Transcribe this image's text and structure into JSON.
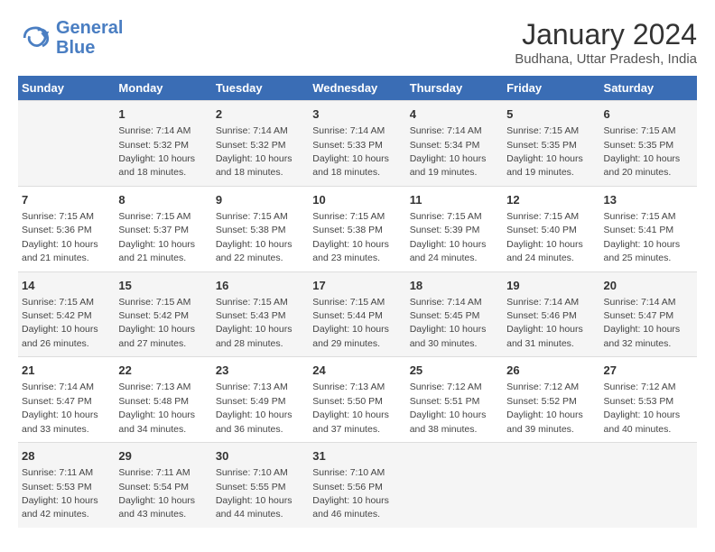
{
  "header": {
    "logo_line1": "General",
    "logo_line2": "Blue",
    "title": "January 2024",
    "subtitle": "Budhana, Uttar Pradesh, India"
  },
  "days_of_week": [
    "Sunday",
    "Monday",
    "Tuesday",
    "Wednesday",
    "Thursday",
    "Friday",
    "Saturday"
  ],
  "weeks": [
    [
      {
        "day": "",
        "info": ""
      },
      {
        "day": "1",
        "info": "Sunrise: 7:14 AM\nSunset: 5:32 PM\nDaylight: 10 hours\nand 18 minutes."
      },
      {
        "day": "2",
        "info": "Sunrise: 7:14 AM\nSunset: 5:32 PM\nDaylight: 10 hours\nand 18 minutes."
      },
      {
        "day": "3",
        "info": "Sunrise: 7:14 AM\nSunset: 5:33 PM\nDaylight: 10 hours\nand 18 minutes."
      },
      {
        "day": "4",
        "info": "Sunrise: 7:14 AM\nSunset: 5:34 PM\nDaylight: 10 hours\nand 19 minutes."
      },
      {
        "day": "5",
        "info": "Sunrise: 7:15 AM\nSunset: 5:35 PM\nDaylight: 10 hours\nand 19 minutes."
      },
      {
        "day": "6",
        "info": "Sunrise: 7:15 AM\nSunset: 5:35 PM\nDaylight: 10 hours\nand 20 minutes."
      }
    ],
    [
      {
        "day": "7",
        "info": "Sunrise: 7:15 AM\nSunset: 5:36 PM\nDaylight: 10 hours\nand 21 minutes."
      },
      {
        "day": "8",
        "info": "Sunrise: 7:15 AM\nSunset: 5:37 PM\nDaylight: 10 hours\nand 21 minutes."
      },
      {
        "day": "9",
        "info": "Sunrise: 7:15 AM\nSunset: 5:38 PM\nDaylight: 10 hours\nand 22 minutes."
      },
      {
        "day": "10",
        "info": "Sunrise: 7:15 AM\nSunset: 5:38 PM\nDaylight: 10 hours\nand 23 minutes."
      },
      {
        "day": "11",
        "info": "Sunrise: 7:15 AM\nSunset: 5:39 PM\nDaylight: 10 hours\nand 24 minutes."
      },
      {
        "day": "12",
        "info": "Sunrise: 7:15 AM\nSunset: 5:40 PM\nDaylight: 10 hours\nand 24 minutes."
      },
      {
        "day": "13",
        "info": "Sunrise: 7:15 AM\nSunset: 5:41 PM\nDaylight: 10 hours\nand 25 minutes."
      }
    ],
    [
      {
        "day": "14",
        "info": "Sunrise: 7:15 AM\nSunset: 5:42 PM\nDaylight: 10 hours\nand 26 minutes."
      },
      {
        "day": "15",
        "info": "Sunrise: 7:15 AM\nSunset: 5:42 PM\nDaylight: 10 hours\nand 27 minutes."
      },
      {
        "day": "16",
        "info": "Sunrise: 7:15 AM\nSunset: 5:43 PM\nDaylight: 10 hours\nand 28 minutes."
      },
      {
        "day": "17",
        "info": "Sunrise: 7:15 AM\nSunset: 5:44 PM\nDaylight: 10 hours\nand 29 minutes."
      },
      {
        "day": "18",
        "info": "Sunrise: 7:14 AM\nSunset: 5:45 PM\nDaylight: 10 hours\nand 30 minutes."
      },
      {
        "day": "19",
        "info": "Sunrise: 7:14 AM\nSunset: 5:46 PM\nDaylight: 10 hours\nand 31 minutes."
      },
      {
        "day": "20",
        "info": "Sunrise: 7:14 AM\nSunset: 5:47 PM\nDaylight: 10 hours\nand 32 minutes."
      }
    ],
    [
      {
        "day": "21",
        "info": "Sunrise: 7:14 AM\nSunset: 5:47 PM\nDaylight: 10 hours\nand 33 minutes."
      },
      {
        "day": "22",
        "info": "Sunrise: 7:13 AM\nSunset: 5:48 PM\nDaylight: 10 hours\nand 34 minutes."
      },
      {
        "day": "23",
        "info": "Sunrise: 7:13 AM\nSunset: 5:49 PM\nDaylight: 10 hours\nand 36 minutes."
      },
      {
        "day": "24",
        "info": "Sunrise: 7:13 AM\nSunset: 5:50 PM\nDaylight: 10 hours\nand 37 minutes."
      },
      {
        "day": "25",
        "info": "Sunrise: 7:12 AM\nSunset: 5:51 PM\nDaylight: 10 hours\nand 38 minutes."
      },
      {
        "day": "26",
        "info": "Sunrise: 7:12 AM\nSunset: 5:52 PM\nDaylight: 10 hours\nand 39 minutes."
      },
      {
        "day": "27",
        "info": "Sunrise: 7:12 AM\nSunset: 5:53 PM\nDaylight: 10 hours\nand 40 minutes."
      }
    ],
    [
      {
        "day": "28",
        "info": "Sunrise: 7:11 AM\nSunset: 5:53 PM\nDaylight: 10 hours\nand 42 minutes."
      },
      {
        "day": "29",
        "info": "Sunrise: 7:11 AM\nSunset: 5:54 PM\nDaylight: 10 hours\nand 43 minutes."
      },
      {
        "day": "30",
        "info": "Sunrise: 7:10 AM\nSunset: 5:55 PM\nDaylight: 10 hours\nand 44 minutes."
      },
      {
        "day": "31",
        "info": "Sunrise: 7:10 AM\nSunset: 5:56 PM\nDaylight: 10 hours\nand 46 minutes."
      },
      {
        "day": "",
        "info": ""
      },
      {
        "day": "",
        "info": ""
      },
      {
        "day": "",
        "info": ""
      }
    ]
  ]
}
